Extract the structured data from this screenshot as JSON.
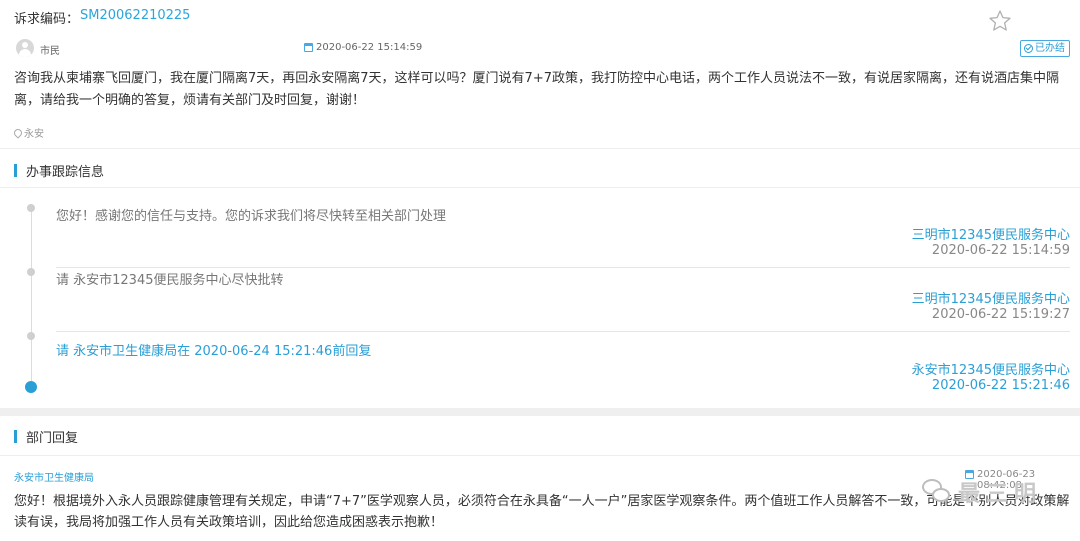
{
  "complaint": {
    "code_label": "诉求编码：",
    "code_value": "SM20062210225",
    "user": "市民",
    "time": "2020-06-22 15:14:59",
    "status": "已办结",
    "content": "咨询我从柬埔寨飞回厦门，我在厦门隔离7天，再回永安隔离7天，这样可以吗？厦门说有7+7政策，我打防控中心电话，两个工作人员说法不一致，有说居家隔离，还有说酒店集中隔离，请给我一个明确的答复，烦请有关部门及时回复，谢谢！",
    "location": "永安"
  },
  "tracking": {
    "title": "办事跟踪信息",
    "entries": [
      {
        "text": "您好！感谢您的信任与支持。您的诉求我们将尽快转至相关部门处理",
        "org": "三明市12345便民服务中心",
        "time": "2020-06-22 15:14:59"
      },
      {
        "text": "请 永安市12345便民服务中心尽快批转",
        "org": "三明市12345便民服务中心",
        "time": "2020-06-22 15:19:27"
      },
      {
        "text": "请 永安市卫生健康局在 2020-06-24 15:21:46前回复",
        "org": "永安市12345便民服务中心",
        "time": "2020-06-22 15:21:46"
      }
    ]
  },
  "reply": {
    "title": "部门回复",
    "org": "永安市卫生健康局",
    "time": "2020-06-23 08:42:08",
    "content": "您好！根据境外入永人员跟踪健康管理有关规定，申请“7+7”医学观察人员，必须符合在永具备“一人一户”居家医学观察条件。两个值班工作人员解答不一致，可能是个别人员对政策解读有误，我局将加强工作人员有关政策培训，因此给您造成困惑表示抱歉！"
  },
  "watermark": "最三明",
  "colors": {
    "accent": "#2a9fd6",
    "divider": "#eeeeee"
  }
}
